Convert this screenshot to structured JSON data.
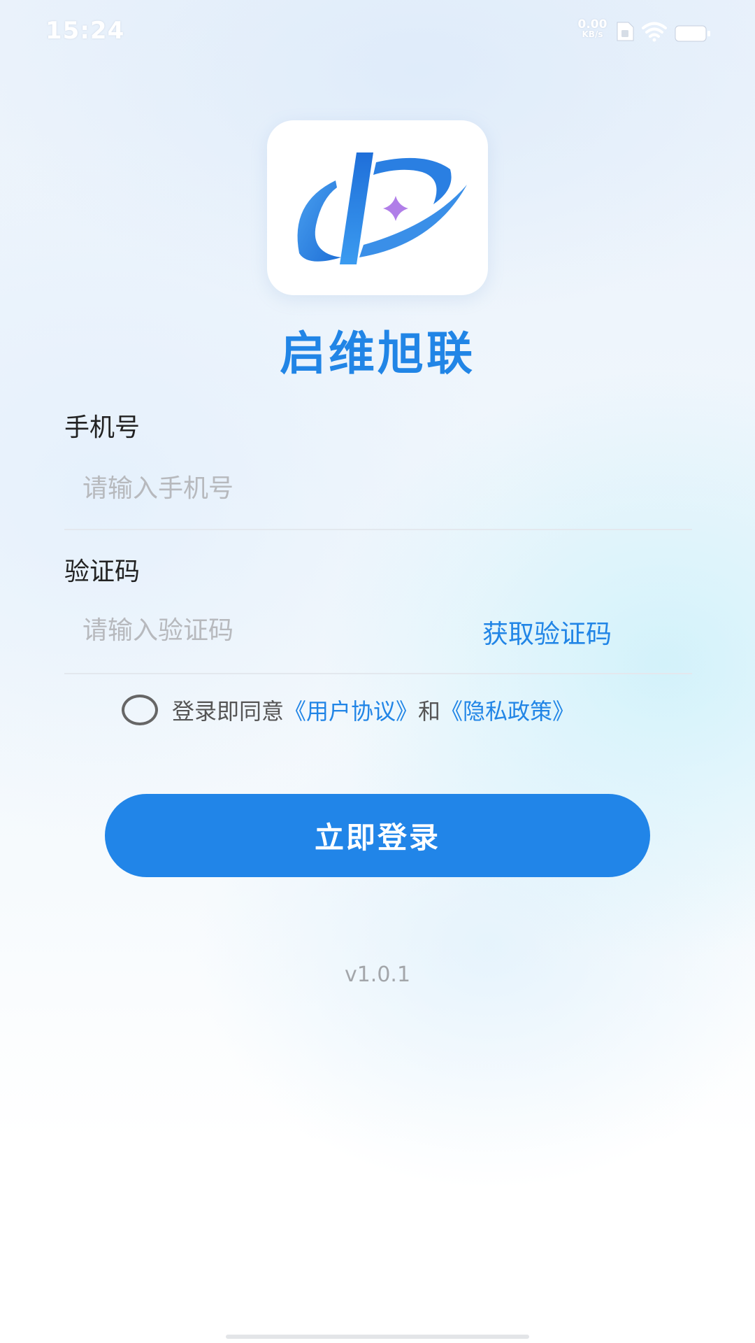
{
  "status_bar": {
    "time": "15:24",
    "net_speed_value": "0.00",
    "net_speed_unit": "KB/s"
  },
  "app": {
    "name": "启维旭联",
    "version": "v1.0.1",
    "brand_color": "#2185e6"
  },
  "form": {
    "phone": {
      "label": "手机号",
      "placeholder": "请输入手机号",
      "value": ""
    },
    "code": {
      "label": "验证码",
      "placeholder": "请输入验证码",
      "value": "",
      "get_code_label": "获取验证码"
    },
    "agreement": {
      "checked": false,
      "prefix": "登录即同意",
      "user_agreement": "《用户协议》",
      "conjunction": "和",
      "privacy_policy": "《隐私政策》"
    },
    "login_label": "立即登录"
  },
  "icons": {
    "sim": "sim-card-icon",
    "wifi": "wifi-icon",
    "battery": "battery-icon",
    "logo": "app-logo-icon"
  }
}
